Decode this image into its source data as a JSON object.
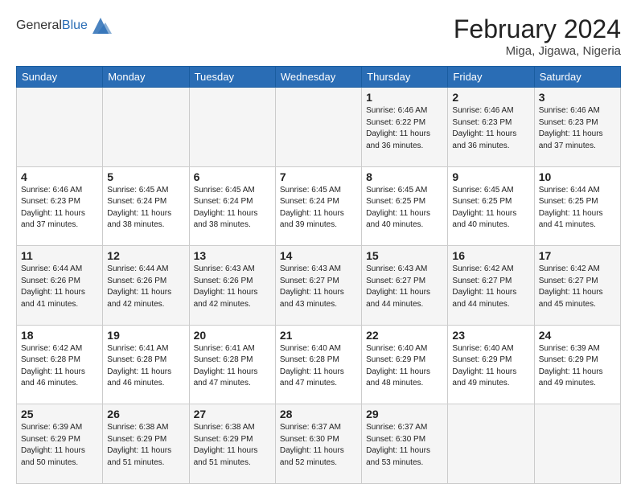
{
  "header": {
    "logo_general": "General",
    "logo_blue": "Blue",
    "month_title": "February 2024",
    "location": "Miga, Jigawa, Nigeria"
  },
  "days_of_week": [
    "Sunday",
    "Monday",
    "Tuesday",
    "Wednesday",
    "Thursday",
    "Friday",
    "Saturday"
  ],
  "weeks": [
    [
      {
        "day": "",
        "info": ""
      },
      {
        "day": "",
        "info": ""
      },
      {
        "day": "",
        "info": ""
      },
      {
        "day": "",
        "info": ""
      },
      {
        "day": "1",
        "info": "Sunrise: 6:46 AM\nSunset: 6:22 PM\nDaylight: 11 hours and 36 minutes."
      },
      {
        "day": "2",
        "info": "Sunrise: 6:46 AM\nSunset: 6:23 PM\nDaylight: 11 hours and 36 minutes."
      },
      {
        "day": "3",
        "info": "Sunrise: 6:46 AM\nSunset: 6:23 PM\nDaylight: 11 hours and 37 minutes."
      }
    ],
    [
      {
        "day": "4",
        "info": "Sunrise: 6:46 AM\nSunset: 6:23 PM\nDaylight: 11 hours and 37 minutes."
      },
      {
        "day": "5",
        "info": "Sunrise: 6:45 AM\nSunset: 6:24 PM\nDaylight: 11 hours and 38 minutes."
      },
      {
        "day": "6",
        "info": "Sunrise: 6:45 AM\nSunset: 6:24 PM\nDaylight: 11 hours and 38 minutes."
      },
      {
        "day": "7",
        "info": "Sunrise: 6:45 AM\nSunset: 6:24 PM\nDaylight: 11 hours and 39 minutes."
      },
      {
        "day": "8",
        "info": "Sunrise: 6:45 AM\nSunset: 6:25 PM\nDaylight: 11 hours and 40 minutes."
      },
      {
        "day": "9",
        "info": "Sunrise: 6:45 AM\nSunset: 6:25 PM\nDaylight: 11 hours and 40 minutes."
      },
      {
        "day": "10",
        "info": "Sunrise: 6:44 AM\nSunset: 6:25 PM\nDaylight: 11 hours and 41 minutes."
      }
    ],
    [
      {
        "day": "11",
        "info": "Sunrise: 6:44 AM\nSunset: 6:26 PM\nDaylight: 11 hours and 41 minutes."
      },
      {
        "day": "12",
        "info": "Sunrise: 6:44 AM\nSunset: 6:26 PM\nDaylight: 11 hours and 42 minutes."
      },
      {
        "day": "13",
        "info": "Sunrise: 6:43 AM\nSunset: 6:26 PM\nDaylight: 11 hours and 42 minutes."
      },
      {
        "day": "14",
        "info": "Sunrise: 6:43 AM\nSunset: 6:27 PM\nDaylight: 11 hours and 43 minutes."
      },
      {
        "day": "15",
        "info": "Sunrise: 6:43 AM\nSunset: 6:27 PM\nDaylight: 11 hours and 44 minutes."
      },
      {
        "day": "16",
        "info": "Sunrise: 6:42 AM\nSunset: 6:27 PM\nDaylight: 11 hours and 44 minutes."
      },
      {
        "day": "17",
        "info": "Sunrise: 6:42 AM\nSunset: 6:27 PM\nDaylight: 11 hours and 45 minutes."
      }
    ],
    [
      {
        "day": "18",
        "info": "Sunrise: 6:42 AM\nSunset: 6:28 PM\nDaylight: 11 hours and 46 minutes."
      },
      {
        "day": "19",
        "info": "Sunrise: 6:41 AM\nSunset: 6:28 PM\nDaylight: 11 hours and 46 minutes."
      },
      {
        "day": "20",
        "info": "Sunrise: 6:41 AM\nSunset: 6:28 PM\nDaylight: 11 hours and 47 minutes."
      },
      {
        "day": "21",
        "info": "Sunrise: 6:40 AM\nSunset: 6:28 PM\nDaylight: 11 hours and 47 minutes."
      },
      {
        "day": "22",
        "info": "Sunrise: 6:40 AM\nSunset: 6:29 PM\nDaylight: 11 hours and 48 minutes."
      },
      {
        "day": "23",
        "info": "Sunrise: 6:40 AM\nSunset: 6:29 PM\nDaylight: 11 hours and 49 minutes."
      },
      {
        "day": "24",
        "info": "Sunrise: 6:39 AM\nSunset: 6:29 PM\nDaylight: 11 hours and 49 minutes."
      }
    ],
    [
      {
        "day": "25",
        "info": "Sunrise: 6:39 AM\nSunset: 6:29 PM\nDaylight: 11 hours and 50 minutes."
      },
      {
        "day": "26",
        "info": "Sunrise: 6:38 AM\nSunset: 6:29 PM\nDaylight: 11 hours and 51 minutes."
      },
      {
        "day": "27",
        "info": "Sunrise: 6:38 AM\nSunset: 6:29 PM\nDaylight: 11 hours and 51 minutes."
      },
      {
        "day": "28",
        "info": "Sunrise: 6:37 AM\nSunset: 6:30 PM\nDaylight: 11 hours and 52 minutes."
      },
      {
        "day": "29",
        "info": "Sunrise: 6:37 AM\nSunset: 6:30 PM\nDaylight: 11 hours and 53 minutes."
      },
      {
        "day": "",
        "info": ""
      },
      {
        "day": "",
        "info": ""
      }
    ]
  ]
}
